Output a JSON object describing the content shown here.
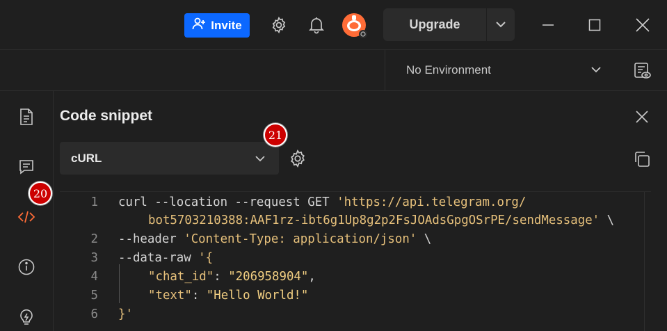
{
  "header": {
    "invite_label": "Invite",
    "upgrade_label": "Upgrade"
  },
  "environment": {
    "selected": "No Environment"
  },
  "panel": {
    "title": "Code snippet",
    "language": "cURL"
  },
  "badges": {
    "language_settings": "21",
    "code_tab": "20"
  },
  "code": {
    "line_numbers": [
      "1",
      "2",
      "3",
      "4",
      "5",
      "6"
    ],
    "line1_cmd": "curl --location --request GET ",
    "line1_url": "'https://api.telegram.org/",
    "line1_cont_url": "bot5703210388:AAF1rz-ibt6g1Up8g2p2FsJOAdsGpgOSrPE/sendMessage'",
    "line1_cont_tail": " \\",
    "line2_cmd": "--header ",
    "line2_str": "'Content-Type: application/json'",
    "line2_tail": " \\",
    "line3_cmd": "--data-raw ",
    "line3_str": "'{",
    "line4_key": "\"chat_id\"",
    "line4_sep": ": ",
    "line4_val": "\"206958904\"",
    "line4_tail": ",",
    "line5_key": "\"text\"",
    "line5_sep": ": ",
    "line5_val": "\"Hello World!\"",
    "line6_str": "}'"
  },
  "icons": {
    "accent": "#ff6c37",
    "invite_bg": "#0c68ff",
    "badge_red": "#cc0000"
  }
}
